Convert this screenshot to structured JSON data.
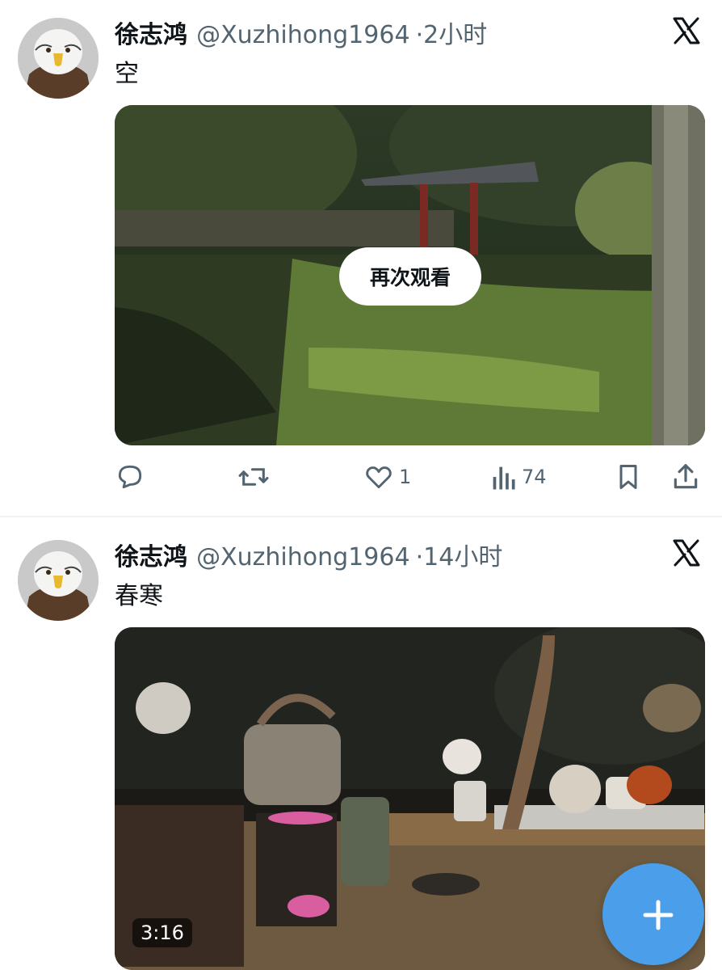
{
  "tweets": [
    {
      "author_name": "徐志鸿",
      "handle": "@Xuzhihong1964",
      "time": "·2小时",
      "text": "空",
      "replay_label": "再次观看",
      "stats": {
        "likes": "1",
        "views": "74"
      }
    },
    {
      "author_name": "徐志鸿",
      "handle": "@Xuzhihong1964",
      "time": "·14小时",
      "text": "春寒",
      "duration": "3:16"
    }
  ],
  "icons": {
    "avatar": "eagle-avatar",
    "platform": "x-logo-icon",
    "reply": "comment-icon",
    "retweet": "retweet-icon",
    "like": "heart-icon",
    "views": "bar-chart-icon",
    "bookmark": "bookmark-icon",
    "share": "share-icon",
    "compose": "plus-icon"
  },
  "colors": {
    "accent": "#4b9eea",
    "text": "#0f1419",
    "secondary": "#536471"
  }
}
